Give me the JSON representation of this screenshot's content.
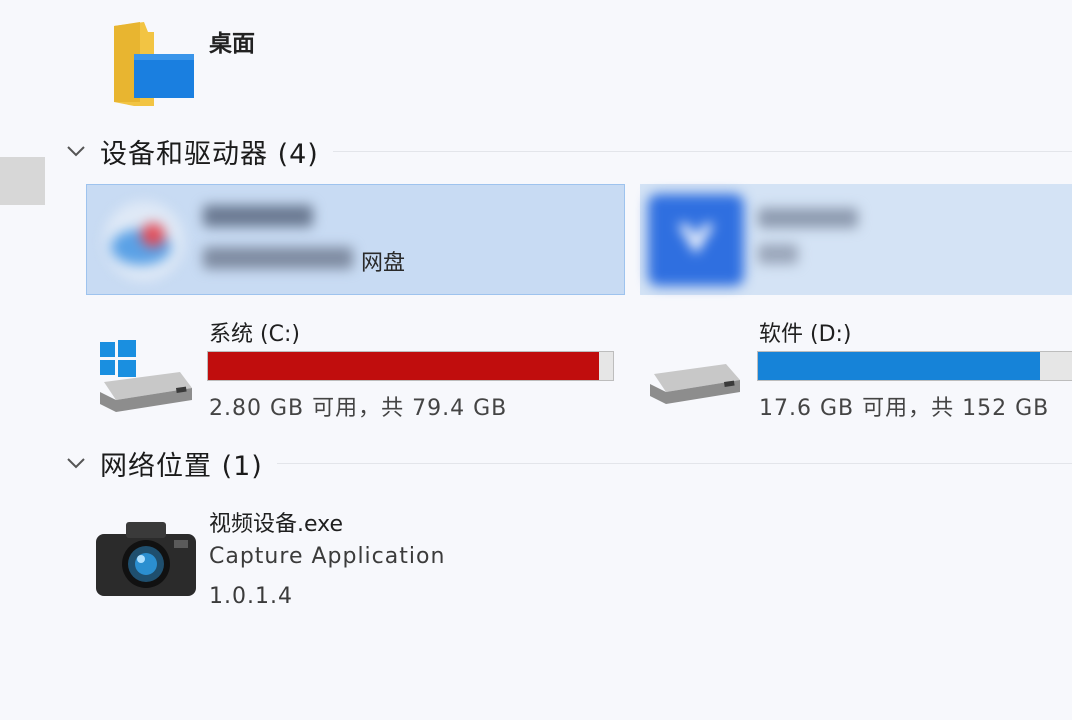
{
  "desktop": {
    "label": "桌面",
    "icon": "folder-icon"
  },
  "devices_section": {
    "title": "设备和驱动器 (4)"
  },
  "cloud_tile_a": {
    "name": "",
    "sub_suffix": "网盘",
    "icon": "cloud-app-icon"
  },
  "cloud_tile_b": {
    "name": "",
    "icon": "cloud-drive-icon"
  },
  "drives": [
    {
      "name": "系统 (C:)",
      "free_text": "2.80 GB 可用，共 79.4 GB",
      "used_fraction": 0.965,
      "bar_color": "#c00d0d",
      "icon": "windows-drive-icon"
    },
    {
      "name": "软件 (D:)",
      "free_text": "17.6 GB 可用，共 152 GB",
      "used_fraction": 0.884,
      "bar_color": "#1683d8",
      "icon": "hard-drive-icon"
    }
  ],
  "network_section": {
    "title": "网络位置 (1)"
  },
  "network_item": {
    "name": "视频设备.exe",
    "description": "Capture Application",
    "version": "1.0.1.4",
    "icon": "camera-icon"
  },
  "colors": {
    "selection": "#c8dbf3",
    "selection_border": "#9ec3ee",
    "low_space": "#c00d0d",
    "normal_space": "#1683d8"
  }
}
